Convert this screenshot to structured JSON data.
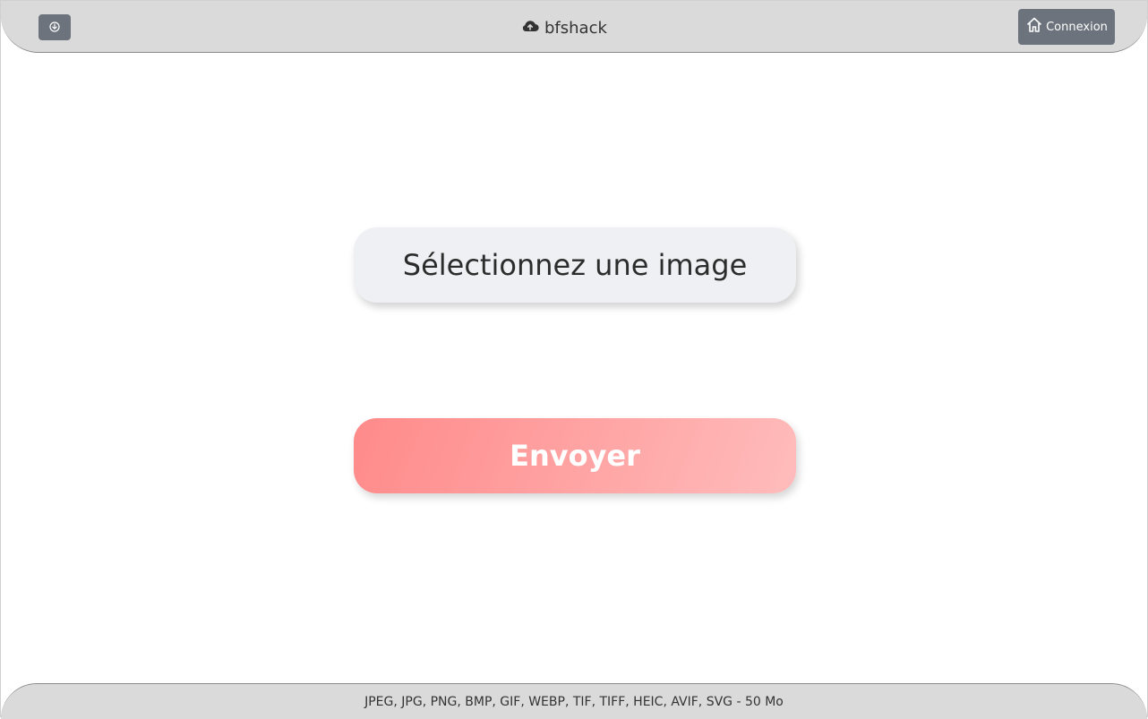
{
  "header": {
    "download_icon": "download-icon",
    "brand_icon": "cloud-upload-icon",
    "brand_name": "bfshack",
    "login_icon": "home-icon",
    "login_label": "Connexion"
  },
  "main": {
    "select_label": "Sélectionnez une image",
    "send_label": "Envoyer"
  },
  "footer": {
    "formats_text": "JPEG, JPG, PNG, BMP, GIF, WEBP, TIF, TIFF, HEIC, AVIF, SVG - 50 Mo"
  },
  "colors": {
    "header_bg": "#dadada",
    "button_gray": "#6c737c",
    "select_bg": "#eef0f3",
    "send_gradient_start": "#ff8a8a",
    "send_gradient_end": "#ffbcbc"
  }
}
